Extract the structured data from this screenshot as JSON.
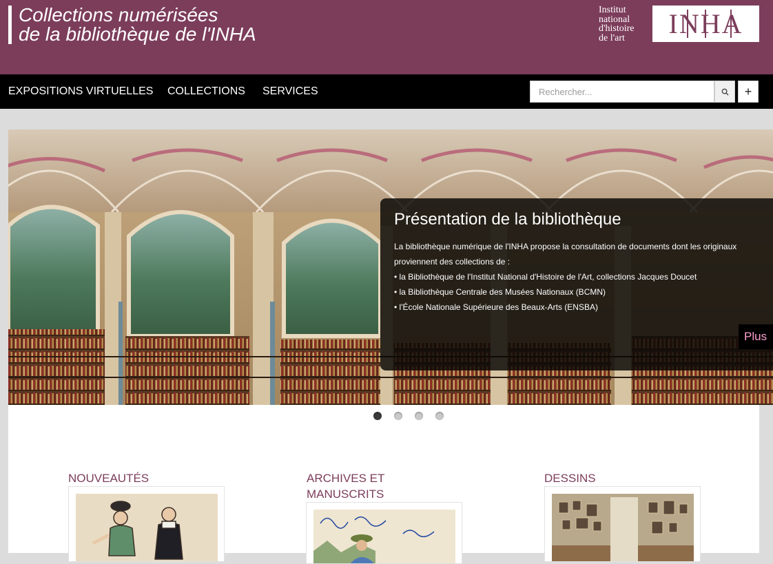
{
  "header": {
    "title_line1": "Collections numérisées",
    "title_line2": "de la bibliothèque de l'INHA",
    "institute_lines": [
      "Institut",
      "national",
      "d'histoire",
      "de l'art"
    ],
    "logo_text": "INHA",
    "background_color": "#7c3d5b"
  },
  "nav": {
    "items": [
      "EXPOSITIONS VIRTUELLES",
      "COLLECTIONS",
      "SERVICES"
    ],
    "search_placeholder": "Rechercher...",
    "search_icon": "search-icon",
    "plus_label": "+"
  },
  "slider": {
    "caption_title": "Présentation de la bibliothèque",
    "caption_lines": [
      "La bibliothèque numérique de l'INHA propose la consultation de documents dont les originaux proviennent des collections de :",
      "• la Bibliothèque de l'Institut National d'Histoire de l'Art, collections Jacques Doucet",
      "• la Bibliothèque Centrale des Musées Nationaux (BCMN)",
      "• l'École Nationale Supérieure des Beaux-Arts (ENSBA)"
    ],
    "more_label": "Plus",
    "slide_count": 4,
    "active_slide": 1
  },
  "categories": [
    {
      "title": "NOUVEAUTÉS"
    },
    {
      "title": "ARCHIVES ET MANUSCRITS"
    },
    {
      "title": "DESSINS"
    }
  ],
  "colors": {
    "accent": "#7c3d5b",
    "nav_background": "#000000",
    "more_link": "#ff9fcf"
  }
}
